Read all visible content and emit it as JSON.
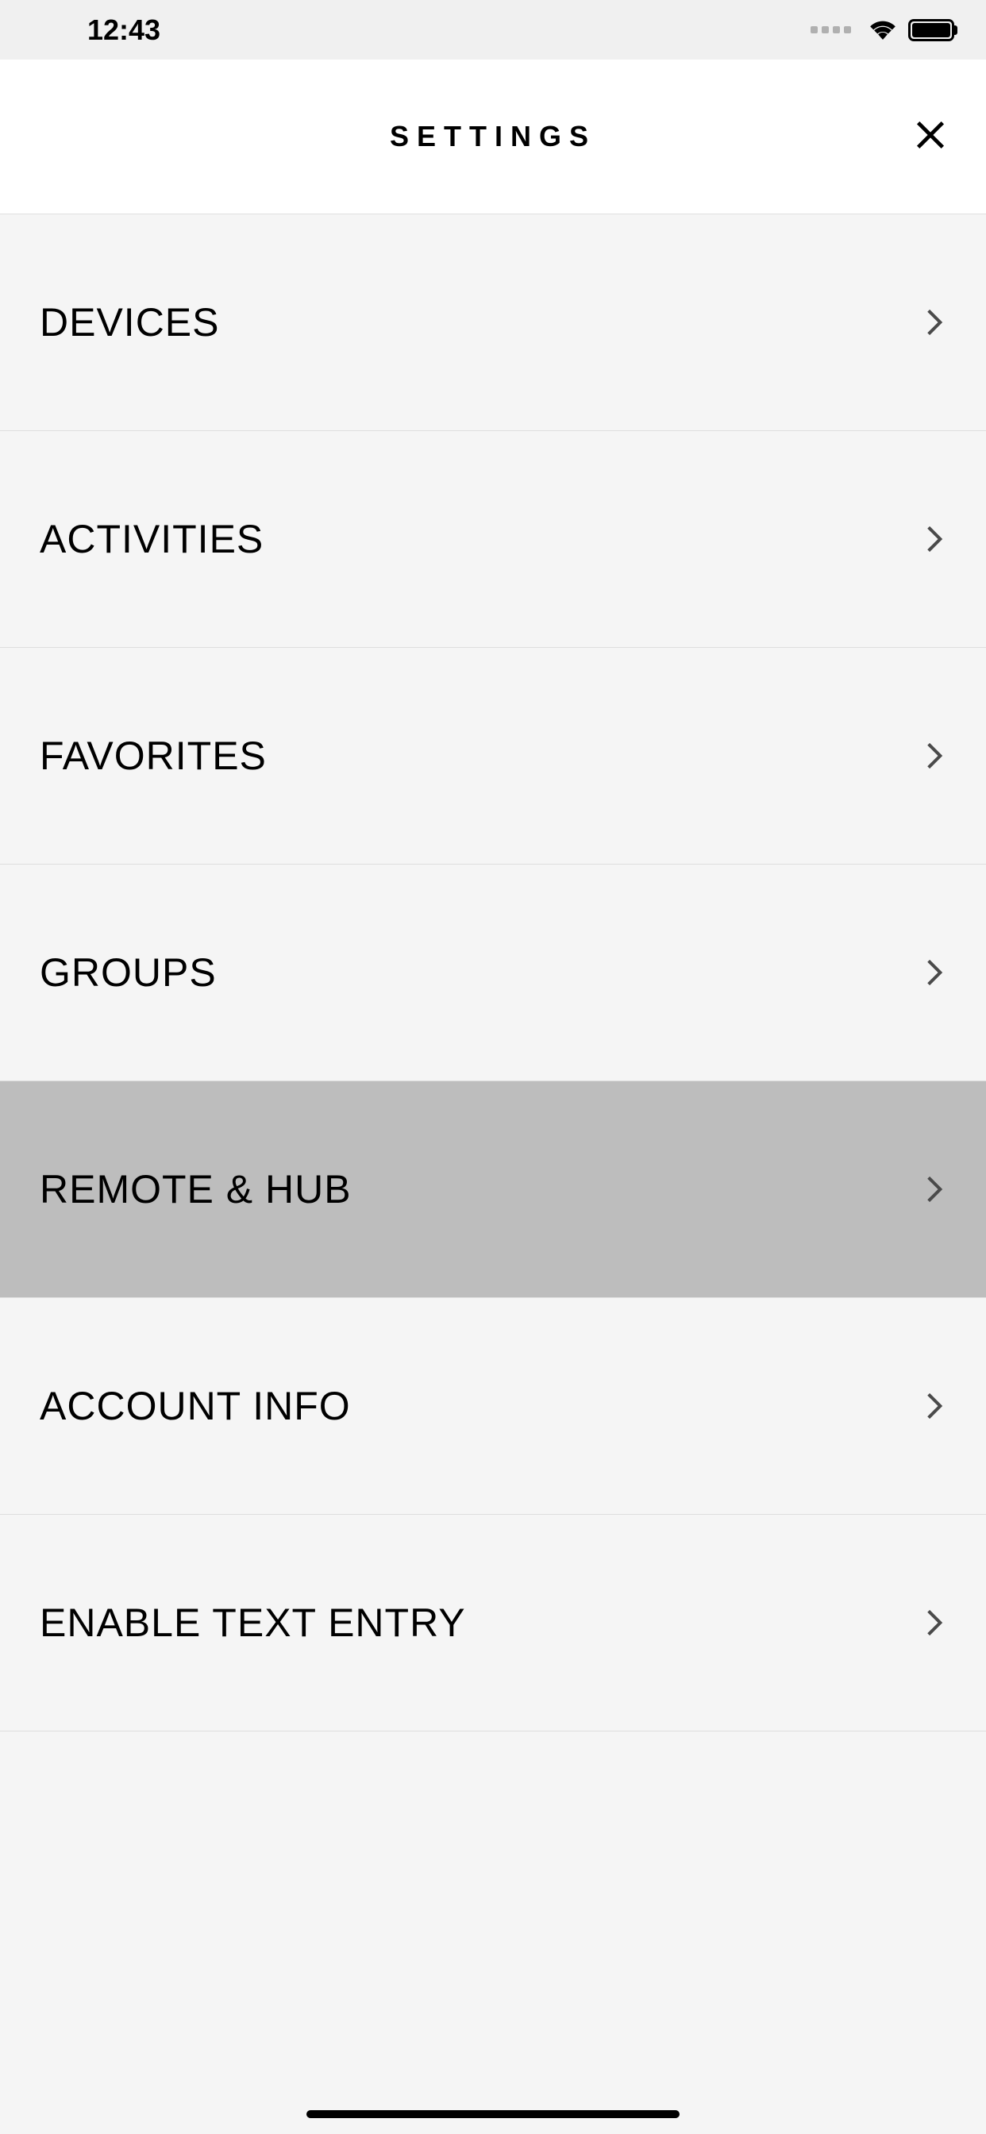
{
  "statusBar": {
    "time": "12:43"
  },
  "header": {
    "title": "SETTINGS"
  },
  "settings": {
    "items": [
      {
        "label": "DEVICES",
        "selected": false
      },
      {
        "label": "ACTIVITIES",
        "selected": false
      },
      {
        "label": "FAVORITES",
        "selected": false
      },
      {
        "label": "GROUPS",
        "selected": false
      },
      {
        "label": "REMOTE & HUB",
        "selected": true
      },
      {
        "label": "ACCOUNT INFO",
        "selected": false
      },
      {
        "label": "ENABLE TEXT ENTRY",
        "selected": false
      }
    ]
  }
}
